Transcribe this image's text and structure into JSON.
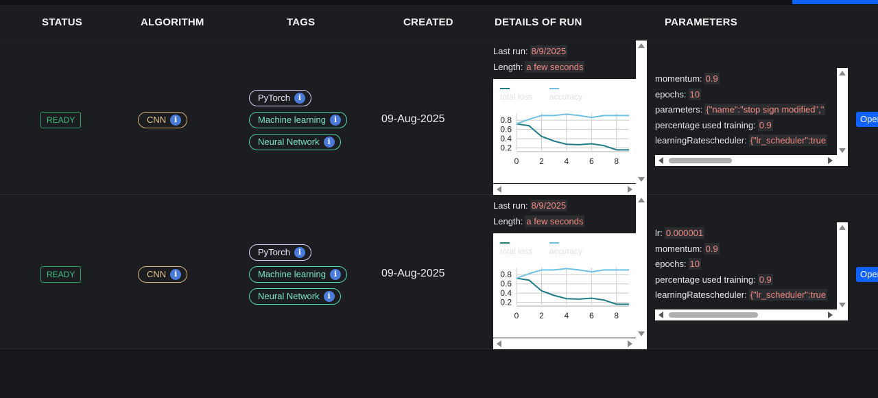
{
  "header": {
    "status": "STATUS",
    "algorithm": "ALGORITHM",
    "tags": "TAGS",
    "created": "CREATED",
    "details": "DETAILS OF RUN",
    "parameters": "PARAMETERS"
  },
  "rows": [
    {
      "status": "READY",
      "algorithm": "CNN",
      "tags": [
        "PyTorch",
        "Machine learning",
        "Neural Network"
      ],
      "created": "09-Aug-2025",
      "last_run_label": "Last run:",
      "last_run": "8/9/2025",
      "length_label": "Length:",
      "length": "a few seconds",
      "parameters": [
        {
          "key": "momentum:",
          "value": "0.9"
        },
        {
          "key": "epochs:",
          "value": "10"
        },
        {
          "key": "parameters:",
          "value": "{\"name\":\"stop sign modified\",\""
        },
        {
          "key": "percentage used training:",
          "value": "0.9"
        },
        {
          "key": "learningRatescheduler:",
          "value": "{\"lr_scheduler\":true"
        }
      ],
      "open_label": "Open"
    },
    {
      "status": "READY",
      "algorithm": "CNN",
      "tags": [
        "PyTorch",
        "Machine learning",
        "Neural Network"
      ],
      "created": "09-Aug-2025",
      "last_run_label": "Last run:",
      "last_run": "8/9/2025",
      "length_label": "Length:",
      "length": "a few seconds",
      "parameters": [
        {
          "key": "lr:",
          "value": "0.000001"
        },
        {
          "key": "momentum:",
          "value": "0.9"
        },
        {
          "key": "epochs:",
          "value": "10"
        },
        {
          "key": "percentage used training:",
          "value": "0.9"
        },
        {
          "key": "learningRatescheduler:",
          "value": "{\"lr_scheduler\":true"
        }
      ],
      "open_label": "Open"
    }
  ],
  "chart_data": [
    {
      "type": "line",
      "x": [
        0,
        1,
        2,
        3,
        4,
        5,
        6,
        7,
        8,
        9
      ],
      "xticks": [
        "0",
        "2",
        "4",
        "6",
        "8"
      ],
      "yticks": [
        "0.2",
        "0.4",
        "0.6",
        "0.8"
      ],
      "ylim": [
        0.15,
        0.95
      ],
      "series": [
        {
          "name": "total loss",
          "color": "#1e7c86",
          "values": [
            0.72,
            0.68,
            0.45,
            0.35,
            0.28,
            0.27,
            0.29,
            0.25,
            0.16,
            0.16
          ]
        },
        {
          "name": "accuracy",
          "color": "#6ec1e4",
          "values": [
            0.72,
            0.82,
            0.9,
            0.9,
            0.93,
            0.9,
            0.86,
            0.9,
            0.9,
            0.9
          ]
        }
      ]
    },
    {
      "type": "line",
      "x": [
        0,
        1,
        2,
        3,
        4,
        5,
        6,
        7,
        8,
        9
      ],
      "xticks": [
        "0",
        "2",
        "4",
        "6",
        "8"
      ],
      "yticks": [
        "0.2",
        "0.4",
        "0.6",
        "0.8"
      ],
      "ylim": [
        0.15,
        0.95
      ],
      "series": [
        {
          "name": "total loss",
          "color": "#1e7c86",
          "values": [
            0.72,
            0.68,
            0.45,
            0.35,
            0.28,
            0.27,
            0.29,
            0.25,
            0.16,
            0.16
          ]
        },
        {
          "name": "accuracy",
          "color": "#6ec1e4",
          "values": [
            0.72,
            0.82,
            0.9,
            0.9,
            0.93,
            0.9,
            0.86,
            0.9,
            0.9,
            0.9
          ]
        }
      ]
    }
  ]
}
